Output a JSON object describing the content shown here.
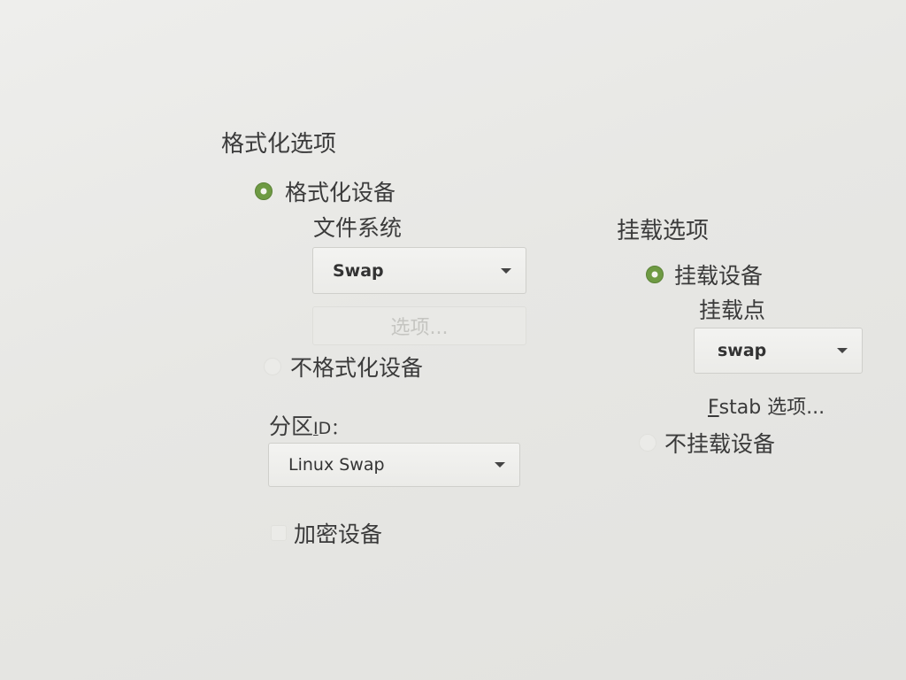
{
  "format_section": {
    "title": "格式化选项",
    "format_device_label": "格式化设备",
    "filesystem_label": "文件系统",
    "filesystem_value": "Swap",
    "options_button_label": "选项...",
    "no_format_label": "不格式化设备",
    "partition_id_label_prefix": "分区",
    "partition_id_mnemonic": "I",
    "partition_id_label_suffix": "D：",
    "partition_id_value": "Linux Swap",
    "encrypt_label": "加密设备"
  },
  "mount_section": {
    "title": "挂载选项",
    "mount_device_label": "挂载设备",
    "mount_point_label": "挂载点",
    "mount_point_value": "swap",
    "fstab_mnemonic": "F",
    "fstab_label_rest": "stab 选项...",
    "no_mount_label": "不挂载设备"
  },
  "colors": {
    "radio_selected": "#6e9a43",
    "background": "#e7e7e4"
  },
  "icons": {
    "combo_caret": "dropdown-arrow-icon"
  }
}
